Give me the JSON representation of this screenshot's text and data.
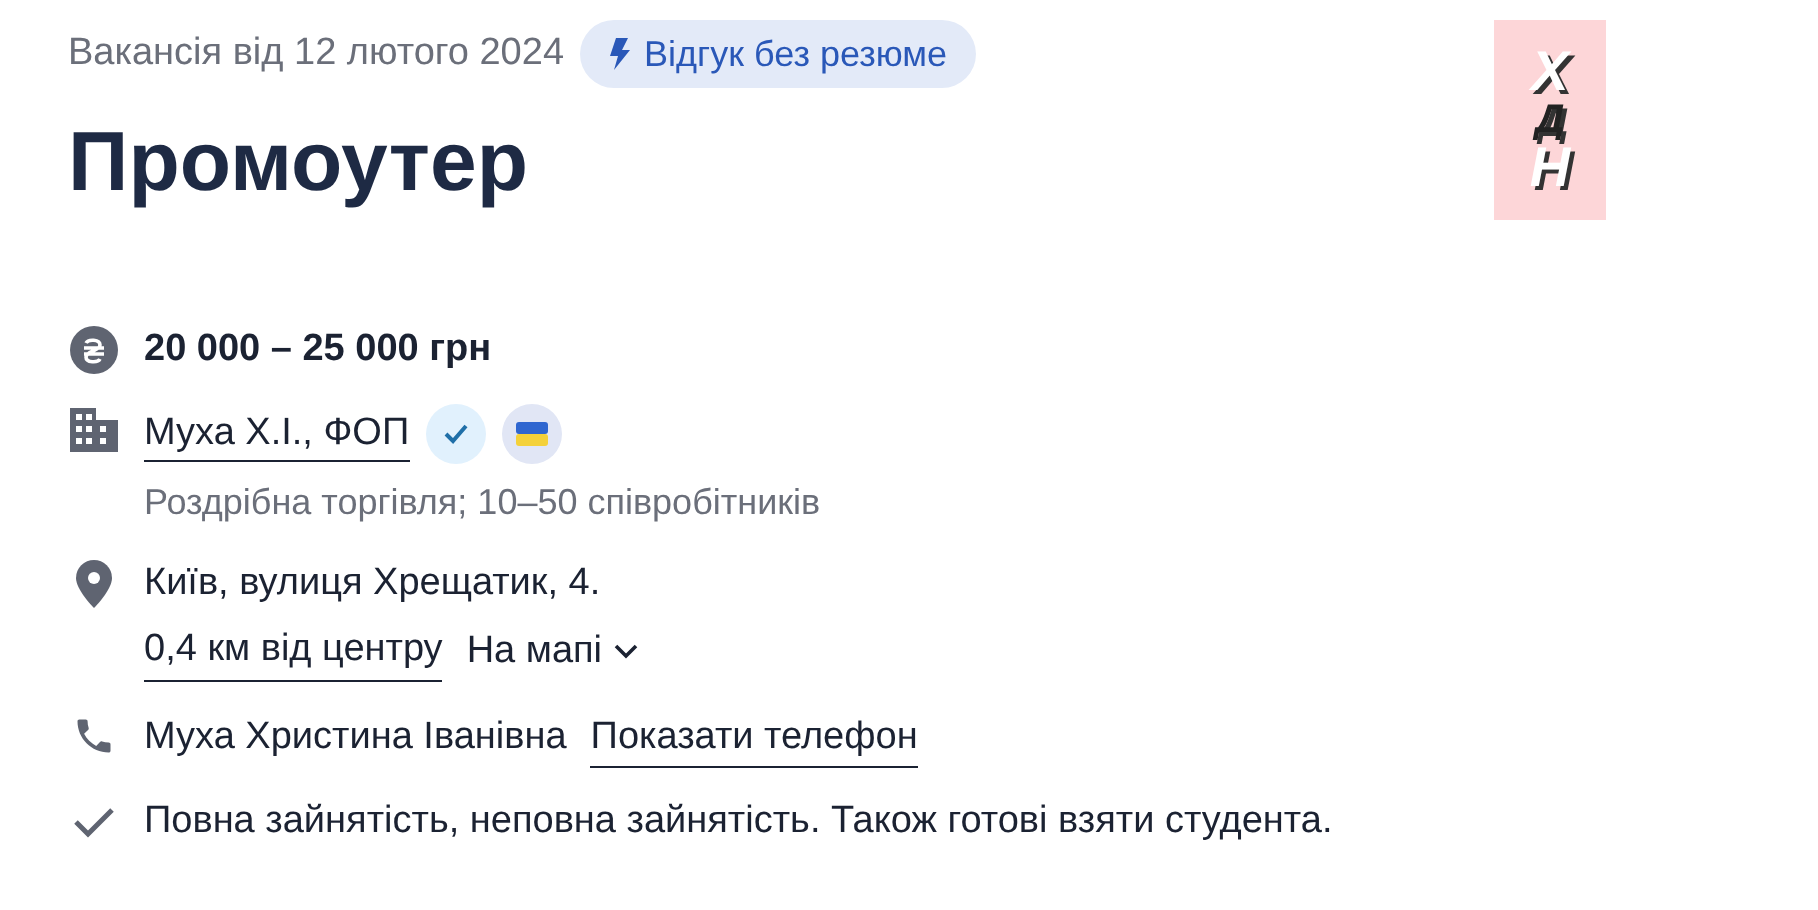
{
  "posted": "Вакансія від 12 лютого 2024",
  "badge": "Відгук без резюме",
  "title": "Промоутер",
  "logo": {
    "letters": [
      "Х",
      "Д",
      "Н"
    ]
  },
  "salary": "20 000 – 25 000 грн",
  "company": {
    "name": "Муха Х.І., ФОП",
    "verified": true,
    "ukrainian": true,
    "details": "Роздрібна торгівля; 10–50 співробітників"
  },
  "address": {
    "text": "Київ, вулиця Хрещатик, 4.",
    "distance": "0,4 км від центру",
    "map": "На мапі"
  },
  "contact": {
    "name": "Муха Христина Іванівна",
    "phone_link": "Показати телефон"
  },
  "employment": "Повна зайнятість, неповна зайнятість. Також готові взяти студента."
}
